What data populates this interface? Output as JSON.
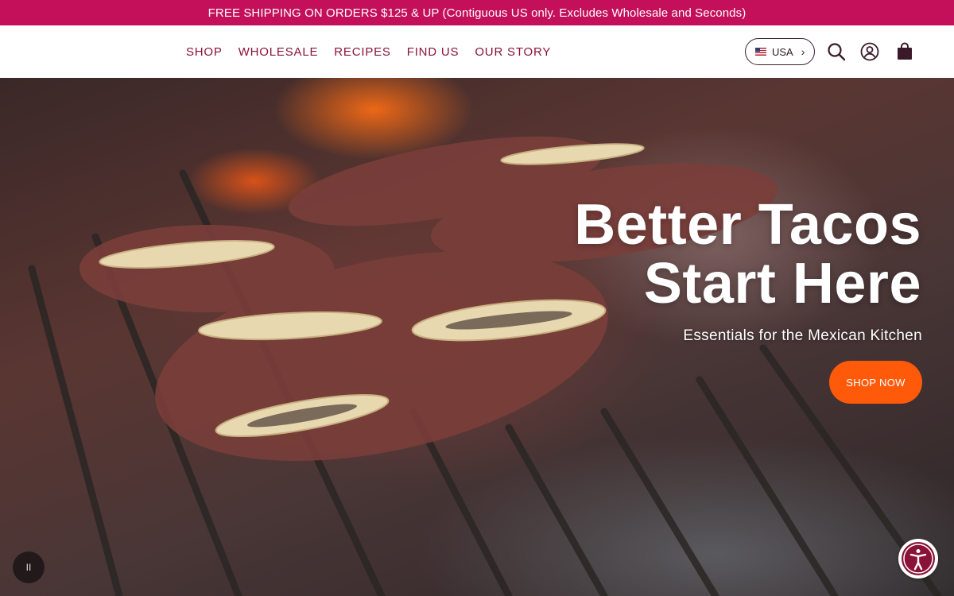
{
  "announcement": {
    "text": "FREE SHIPPING ON ORDERS $125 & UP (Contiguous US only. Excludes Wholesale and Seconds)"
  },
  "nav": {
    "items": [
      {
        "label": "SHOP"
      },
      {
        "label": "WHOLESALE"
      },
      {
        "label": "RECIPES"
      },
      {
        "label": "FIND US"
      },
      {
        "label": "OUR STORY"
      }
    ]
  },
  "header": {
    "locale_label": "USA",
    "icons": [
      "search-icon",
      "account-icon",
      "cart-icon"
    ],
    "accent_color": "#8a1238"
  },
  "hero": {
    "headline_line1": "Better Tacos",
    "headline_line2": "Start Here",
    "subheadline": "Essentials for the Mexican Kitchen",
    "cta_label": "SHOP NOW",
    "cta_color": "#ff5a0a",
    "pause_label": "II"
  },
  "brand_color": "#c4105a"
}
